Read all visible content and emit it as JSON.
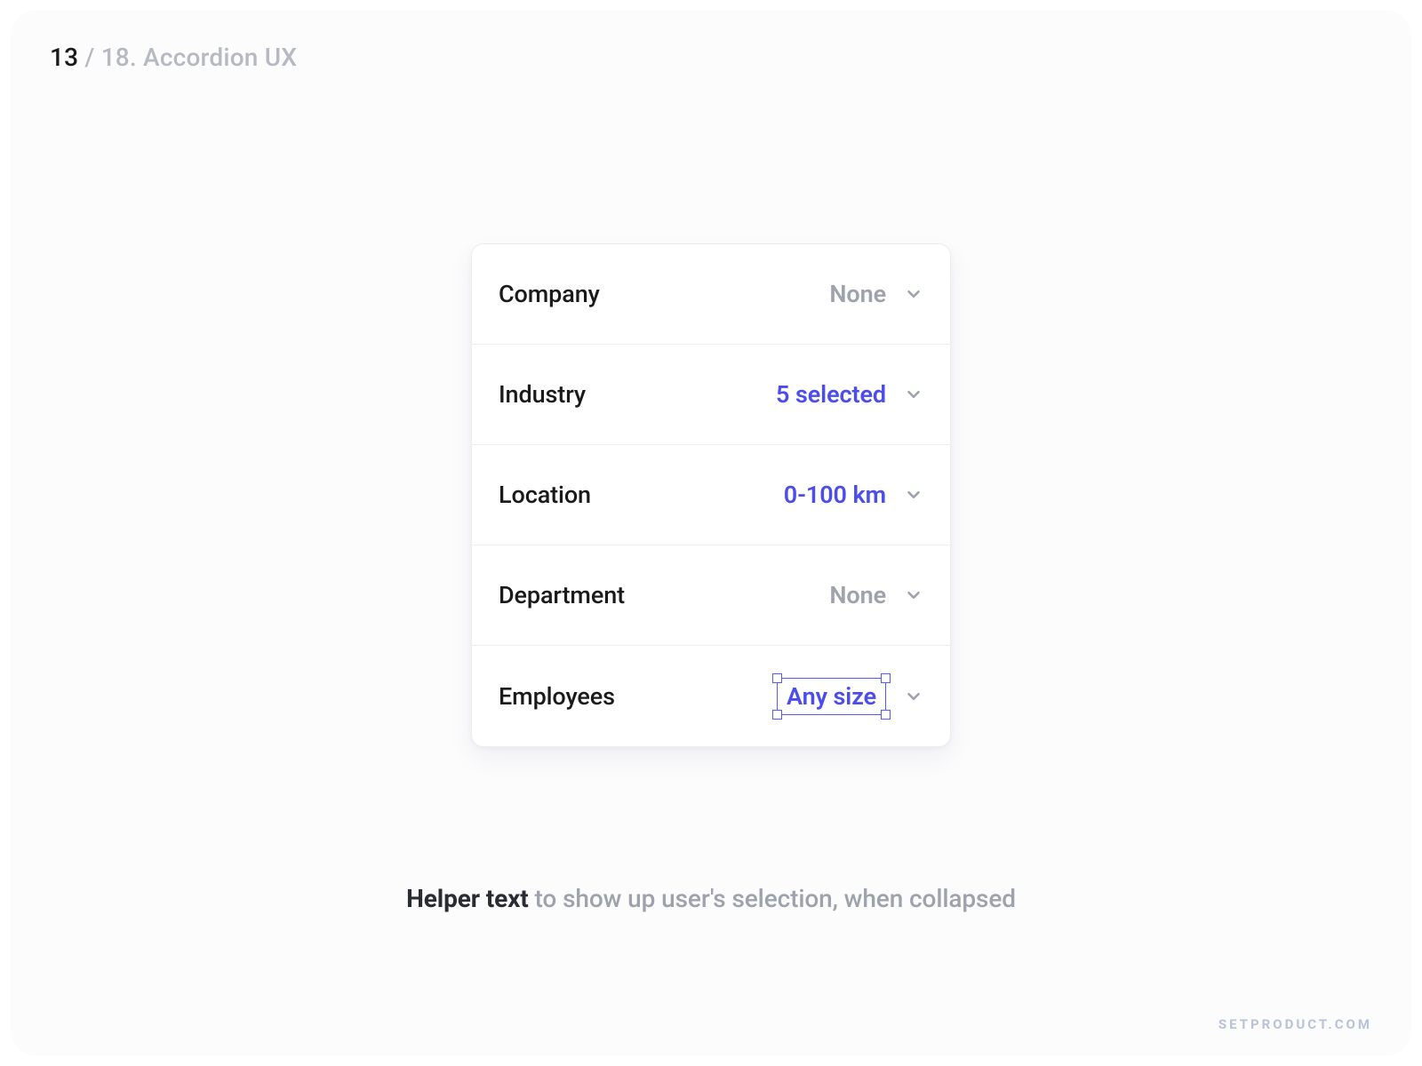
{
  "header": {
    "current": "13",
    "separator": " / ",
    "total": "18",
    "title": ". Accordion UX"
  },
  "accordion": {
    "rows": [
      {
        "label": "Company",
        "value": "None",
        "style": "muted",
        "highlighted": false
      },
      {
        "label": "Industry",
        "value": "5 selected",
        "style": "active",
        "highlighted": false
      },
      {
        "label": "Location",
        "value": "0-100 km",
        "style": "active",
        "highlighted": false
      },
      {
        "label": "Department",
        "value": "None",
        "style": "muted",
        "highlighted": false
      },
      {
        "label": "Employees",
        "value": "Any size",
        "style": "active",
        "highlighted": true
      }
    ]
  },
  "caption": {
    "bold": "Helper text",
    "rest": " to show up user's selection, when collapsed"
  },
  "watermark": "SETPRODUCT.COM"
}
